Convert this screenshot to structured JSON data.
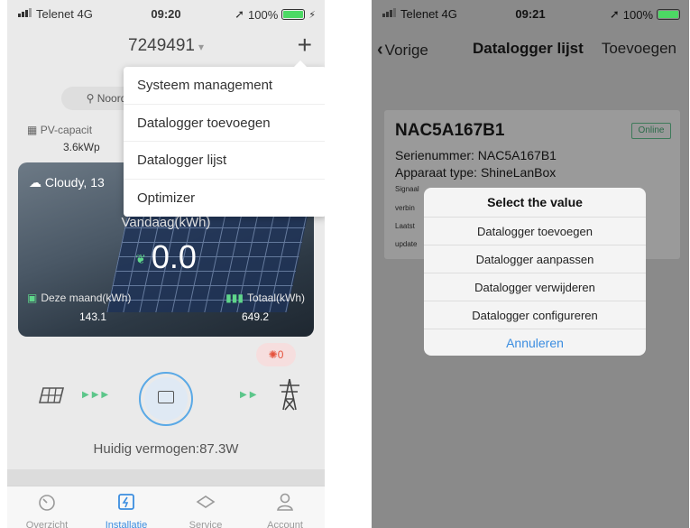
{
  "left": {
    "status": {
      "carrier": "Telenet",
      "network": "4G",
      "time": "09:20",
      "battery": "100%"
    },
    "header": {
      "title": "7249491",
      "caret": "▾",
      "plus": "+"
    },
    "location_pill": "Noord",
    "pv_label": "PV-capacit",
    "pv_value": "3.6kWp",
    "weather": "Cloudy, 13",
    "today_label": "Vandaag(kWh)",
    "today_value": "0.0",
    "month_label": "Deze maand(kWh)",
    "month_value": "143.1",
    "total_label": "Totaal(kWh)",
    "total_value": "649.2",
    "alarm_count": "0",
    "current_power": "Huidig vermogen:87.3W",
    "menu": [
      {
        "label": "Systeem management"
      },
      {
        "label": "Datalogger toevoegen"
      },
      {
        "label": "Datalogger lijst"
      },
      {
        "label": "Optimizer"
      }
    ],
    "tabs": [
      {
        "label": "Overzicht"
      },
      {
        "label": "Installatie"
      },
      {
        "label": "Service"
      },
      {
        "label": "Account"
      }
    ]
  },
  "right": {
    "status": {
      "carrier": "Telenet",
      "network": "4G",
      "time": "09:21",
      "battery": "100%"
    },
    "header": {
      "back": "Vorige",
      "title": "Datalogger lijst",
      "add": "Toevoegen"
    },
    "card": {
      "serial_title": "NAC5A167B1",
      "status_badge": "Online",
      "serial_line": "Serienummer: NAC5A167B1",
      "type_line": "Apparaat type: ShineLanBox",
      "line3": "Signaal",
      "line4": "verbin",
      "line5": "Laatst",
      "line6": "update"
    },
    "dialog": {
      "title": "Select the value",
      "options": [
        "Datalogger toevoegen",
        "Datalogger aanpassen",
        "Datalogger verwijderen",
        "Datalogger configureren"
      ],
      "cancel": "Annuleren"
    }
  },
  "colors": {
    "accent": "#3b8de0",
    "online": "#2c6b4a",
    "flow": "#5cc68a",
    "alarm": "#e5533d"
  }
}
